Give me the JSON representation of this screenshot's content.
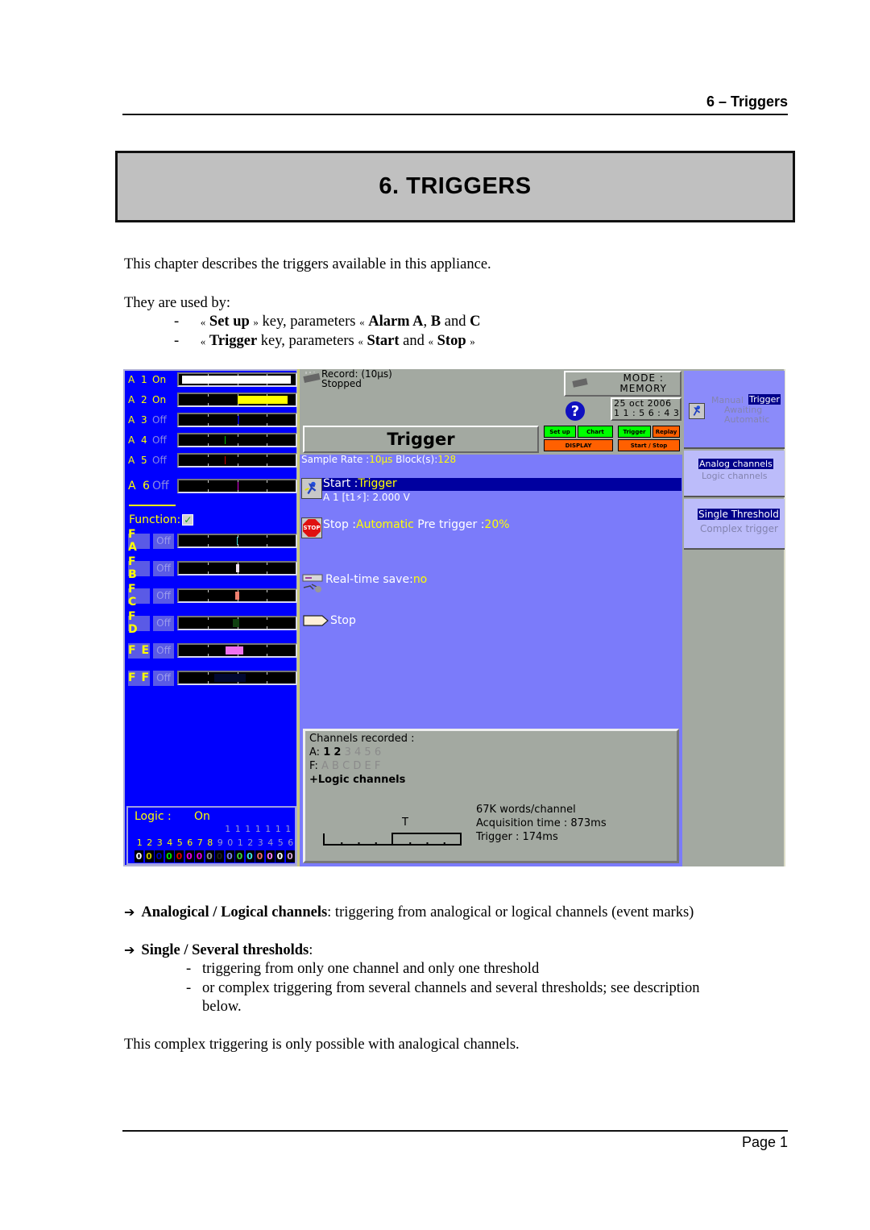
{
  "page": {
    "running_header": "6 – Triggers",
    "chapter_title": "6. TRIGGERS",
    "intro": "This chapter describes the triggers available in this appliance.",
    "used_by": "They are used by:",
    "usage_items": [
      {
        "dash": "-",
        "q1": "«",
        "key": "Set up",
        "q2": "»",
        "mid": " key, parameters ",
        "q3": "«",
        "params": [
          {
            "bold": "Alarm A"
          },
          {
            "text": ", "
          },
          {
            "bold": "B"
          },
          {
            "text": " and "
          },
          {
            "bold": "C"
          }
        ],
        "q4": ""
      },
      {
        "dash": "-",
        "q1": "«",
        "key": "Trigger",
        "q2": "",
        "mid": "  key, parameters ",
        "q3": "«",
        "start": "Start",
        "and": " and ",
        "q5": "«",
        "stop": "Stop",
        "q6": "»"
      }
    ],
    "bullet1": {
      "arrow": "➔",
      "bold": "Analogical / Logical channels",
      "text": ": triggering from analogical or logical channels (event marks)"
    },
    "bullet2": {
      "arrow": "➔",
      "bold": "Single / Several thresholds",
      "text": ":"
    },
    "bullet2_items": [
      {
        "dash": "-",
        "text": "triggering from only one channel and only one threshold"
      },
      {
        "dash": "-",
        "text": "or complex triggering from several channels and several thresholds; see description"
      },
      {
        "dash": "",
        "text": "below."
      }
    ],
    "closing": "This complex triggering is only possible with analogical channels.",
    "page_number": "Page 1"
  },
  "device": {
    "analog_channels": [
      {
        "name": "A 1",
        "state": "On",
        "on": true,
        "fill_color": "#ffffff",
        "fill_from": 0.03,
        "fill_to": 0.96
      },
      {
        "name": "A 2",
        "state": "On",
        "on": true,
        "fill_color": "#ffff00",
        "fill_from": 0.5,
        "fill_to": 0.93
      },
      {
        "name": "A 3",
        "state": "Off",
        "on": false,
        "fill_color": "#0000c0",
        "fill_from": 0.505,
        "fill_to": 0.515
      },
      {
        "name": "A 4",
        "state": "Off",
        "on": false,
        "fill_color": "#00c000",
        "fill_from": 0.39,
        "fill_to": 0.4
      },
      {
        "name": "A 5",
        "state": "Off",
        "on": false,
        "fill_color": "#d00000",
        "fill_from": 0.39,
        "fill_to": 0.4
      },
      {
        "name": "A 6",
        "state": "Off",
        "on": false,
        "fill_color": "#e000e0",
        "fill_from": 0.5,
        "fill_to": 0.51
      }
    ],
    "function_label": "Function:",
    "function_checked": true,
    "function_channels": [
      {
        "name": "F A",
        "state": "Off",
        "fill_color": "#40e0e0",
        "fill_from": 0.495,
        "fill_to": 0.505
      },
      {
        "name": "F B",
        "state": "Off",
        "fill_color": "#f0e0f0",
        "fill_from": 0.49,
        "fill_to": 0.52
      },
      {
        "name": "F C",
        "state": "Off",
        "fill_color": "#f08070",
        "fill_from": 0.48,
        "fill_to": 0.52
      },
      {
        "name": "F D",
        "state": "Off",
        "fill_color": "#104010",
        "fill_from": 0.46,
        "fill_to": 0.52
      },
      {
        "name": "F E",
        "state": "Off",
        "fill_color": "#f070f0",
        "fill_from": 0.4,
        "fill_to": 0.55
      },
      {
        "name": "F F",
        "state": "Off",
        "fill_color": "#000830",
        "fill_from": 0.3,
        "fill_to": 0.57
      }
    ],
    "logic": {
      "label": "Logic :",
      "state": "On",
      "tens": [
        "1",
        "1",
        "1",
        "1",
        "1",
        "1",
        "1"
      ],
      "units": [
        "1",
        "2",
        "3",
        "4",
        "5",
        "6",
        "7",
        "8",
        "9",
        "0",
        "1",
        "2",
        "3",
        "4",
        "5",
        "6"
      ],
      "unit_colors": [
        "#ffff00",
        "#ffff00",
        "#ffff00",
        "#ffff00",
        "#ffff00",
        "#ffff00",
        "#ffff00",
        "#ffff00",
        "#9a9ad0",
        "#9a9ad0",
        "#9a9ad0",
        "#9a9ad0",
        "#9a9ad0",
        "#9a9ad0",
        "#9a9ad0",
        "#9a9ad0"
      ],
      "bits": [
        "0",
        "0",
        "0",
        "0",
        "0",
        "0",
        "0",
        "0",
        "0",
        "0",
        "0",
        "0",
        "0",
        "0",
        "0",
        "0"
      ],
      "bit_colors": [
        "#ffffff",
        "#c0c000",
        "#0000c0",
        "#00e000",
        "#e00000",
        "#e000e0",
        "#e000e0",
        "#909090",
        "#202020",
        "#8080e0",
        "#40d040",
        "#40e0e0",
        "#f07070",
        "#f080f0",
        "#ffffff",
        "#d0a0d0"
      ]
    },
    "record": {
      "line1": "Record: (10µs)",
      "line2": "Stopped"
    },
    "mode": {
      "line1": "MODE :",
      "line2": "MEMORY"
    },
    "date": "25 oct 2006",
    "time": "1 1 :  5 6 :  4 3",
    "screen_title": "Trigger",
    "tabs": {
      "setup": "Set up",
      "chart": "Chart",
      "trigger": "Trigger",
      "replay": "Replay",
      "display": "DISPLAY",
      "start_stop": "Start / Stop"
    },
    "sample_rate": {
      "label": "Sample Rate :",
      "value": "10µs",
      "blocks_label": "  Block(s):",
      "blocks_value": "128"
    },
    "start": {
      "label": "Start :",
      "value": "Trigger",
      "detail": "A 1 [t1⚡]:  2.000 V"
    },
    "stop": {
      "label": "Stop  :",
      "value": "Automatic",
      "pre_label": "   Pre trigger :",
      "pre_value": "20%"
    },
    "stop_icon_text": "STOP",
    "realtime": {
      "label": "Real-time save:",
      "value": "no"
    },
    "action": "Stop",
    "channels_recorded": {
      "title": "Channels recorded :",
      "analog_prefix": "A:",
      "analog_active": [
        "1",
        "2"
      ],
      "analog_inactive": [
        "3",
        "4",
        "5",
        "6"
      ],
      "function_prefix": "F:",
      "function_inactive": [
        "A",
        "B",
        "C",
        "D",
        "E",
        "F"
      ],
      "logic": "+Logic channels",
      "trigger_marker": "T",
      "words": "67K words/channel",
      "acquisition": "Acquisition time : 873ms",
      "trigger_time": "Trigger : 174ms",
      "pre_trigger_fraction": 0.5
    },
    "right_menu": {
      "mode_options": [
        {
          "label": "Manual",
          "selected": false
        },
        {
          "label": "Trigger",
          "selected": true
        },
        {
          "label": "Awaiting",
          "selected": false
        },
        {
          "label": "Automatic",
          "selected": false
        }
      ],
      "channel_options": [
        {
          "label": "Analog channels",
          "selected": true
        },
        {
          "label": "Logic channels",
          "selected": false
        }
      ],
      "threshold_options": [
        {
          "label": "Single Threshold",
          "selected": true
        },
        {
          "label": "Complex trigger",
          "selected": false
        }
      ]
    }
  }
}
